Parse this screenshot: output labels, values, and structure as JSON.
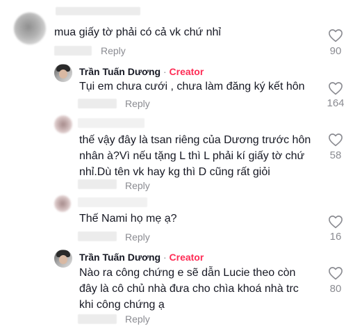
{
  "comments": [
    {
      "text": "mua giấy tờ phải có cả vk chứ nhỉ",
      "reply_label": "Reply",
      "likes": "90",
      "icon": "heart-outline"
    },
    {
      "author": "Trần Tuấn Dương",
      "separator": "·",
      "badge": "Creator",
      "text": "Tụi em chưa cưới , chưa làm đăng ký kết hôn",
      "reply_label": "Reply",
      "likes": "164",
      "icon": "heart-outline"
    },
    {
      "text_lines": [
        "thế vậy đây là tsan riêng của Dương trước hôn",
        "nhân à?Vì nếu tặng L thì L phải kí giấy tờ chứ",
        "nhỉ.Dù tên vk hay kg thì D cũng rất giỏi"
      ],
      "reply_label": "Reply",
      "likes": "58",
      "icon": "heart-outline"
    },
    {
      "text": "Thế Nami họ mẹ ạ?",
      "reply_label": "Reply",
      "likes": "16",
      "icon": "heart-outline"
    },
    {
      "author": "Trần Tuấn Dương",
      "separator": "·",
      "badge": "Creator",
      "text_lines": [
        "Nào ra công chứng e sẽ dẫn Lucie theo còn",
        "đây là cô chủ nhà đưa cho chìa khoá nhà trc",
        "khi công chứng ạ"
      ],
      "reply_label": "Reply",
      "likes": "80",
      "icon": "heart-outline"
    }
  ],
  "colors": {
    "text": "#161823",
    "muted": "#8a8b91",
    "creator_badge": "#fe2c55",
    "background": "#ffffff"
  }
}
